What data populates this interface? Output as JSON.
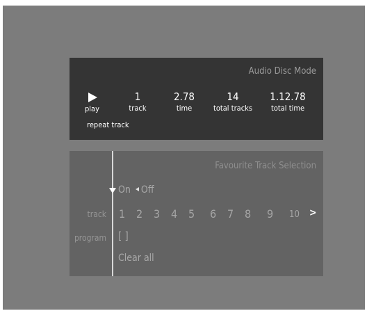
{
  "audio_disc": {
    "title": "Audio Disc Mode",
    "play_label": "play",
    "track_value": "1",
    "track_label": "track",
    "time_value": "2.78",
    "time_label": "time",
    "total_tracks_value": "14",
    "total_tracks_label": "total tracks",
    "total_time_value": "1.12.78",
    "total_time_label": "total time",
    "repeat_label": "repeat track"
  },
  "favourites": {
    "title": "Favourite Track Selection",
    "on_label": "On",
    "off_label": "Off",
    "track_row_label": "track",
    "tracks": [
      "1",
      "2",
      "3",
      "4",
      "5",
      "6",
      "7",
      "8",
      "9",
      "10"
    ],
    "next_label": ">",
    "program_row_label": "program",
    "program_value": "[ ]",
    "clear_all_label": "Clear all"
  }
}
